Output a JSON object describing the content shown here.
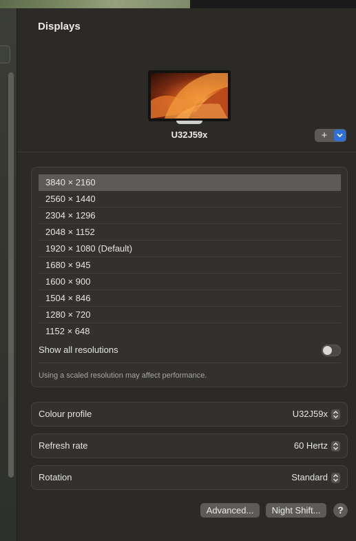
{
  "window": {
    "title": "Displays"
  },
  "display": {
    "name": "U32J59x"
  },
  "add_control": {
    "plus_label": "+"
  },
  "resolutions": [
    {
      "label": "3840 × 2160",
      "selected": true
    },
    {
      "label": "2560 × 1440"
    },
    {
      "label": "2304 × 1296"
    },
    {
      "label": "2048 × 1152"
    },
    {
      "label": "1920 × 1080 (Default)"
    },
    {
      "label": "1680 × 945"
    },
    {
      "label": "1600 × 900"
    },
    {
      "label": "1504 × 846"
    },
    {
      "label": "1280 × 720"
    },
    {
      "label": "1152 × 648"
    }
  ],
  "show_all": {
    "label": "Show all resolutions",
    "enabled": false
  },
  "note": "Using a scaled resolution may affect performance.",
  "settings": {
    "colour_profile": {
      "label": "Colour profile",
      "value": "U32J59x"
    },
    "refresh_rate": {
      "label": "Refresh rate",
      "value": "60 Hertz"
    },
    "rotation": {
      "label": "Rotation",
      "value": "Standard"
    }
  },
  "buttons": {
    "advanced": "Advanced...",
    "night_shift": "Night Shift...",
    "help": "?"
  },
  "colors": {
    "accent": "#2f6fd6",
    "panel": "#2b2a27",
    "selected_row": "#5c5b57"
  },
  "icons": {
    "stepper": "up-down-chevron-icon",
    "dropdown": "chevron-down-icon"
  }
}
